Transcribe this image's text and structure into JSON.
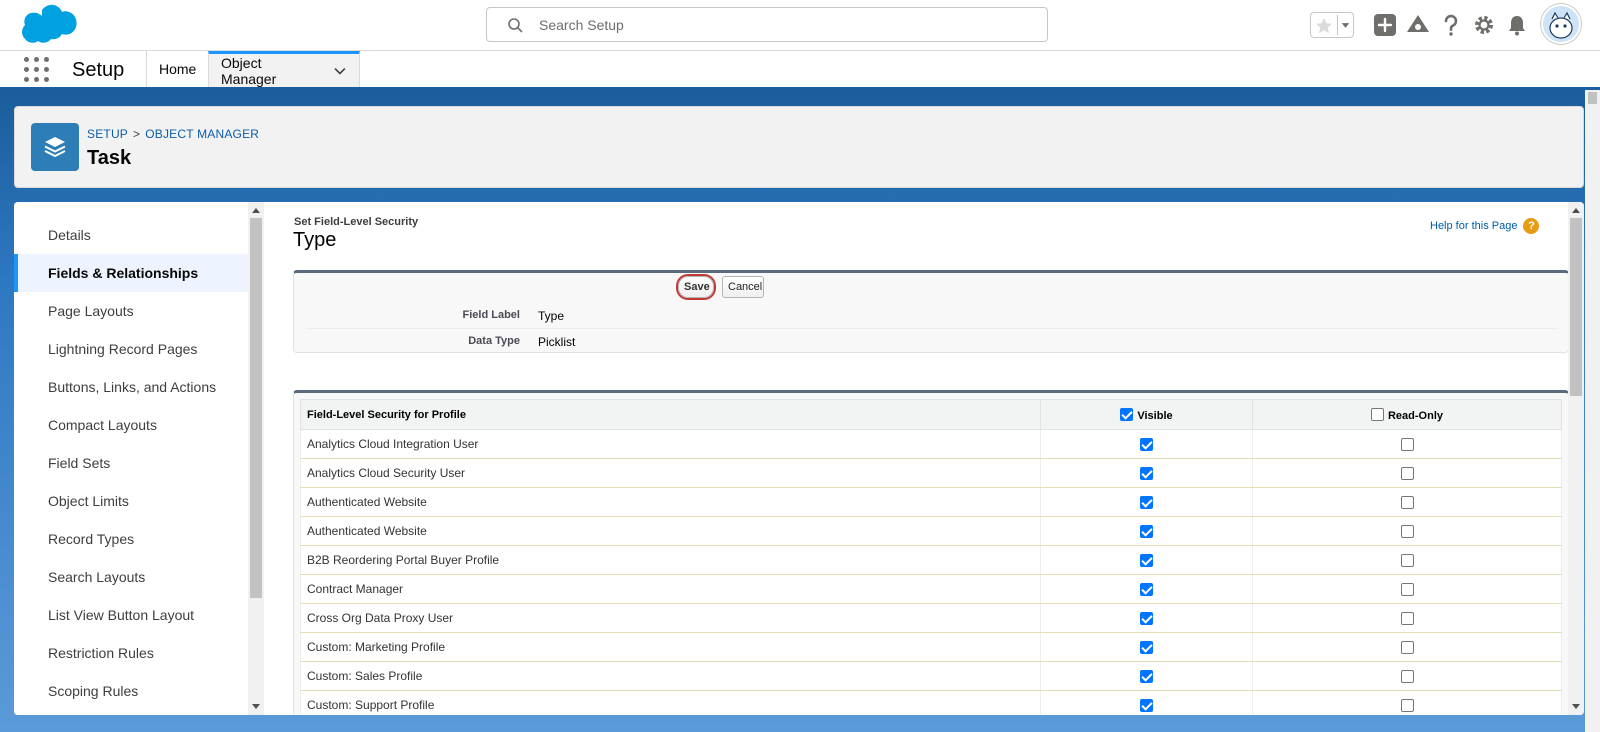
{
  "header": {
    "search_placeholder": "Search Setup",
    "icons": [
      "favorites-star-icon",
      "add-icon",
      "trailhead-icon",
      "help-icon",
      "gear-icon",
      "bell-icon",
      "avatar"
    ]
  },
  "nav": {
    "app_name": "Setup",
    "tabs": [
      {
        "label": "Home"
      },
      {
        "label": "Object Manager"
      }
    ]
  },
  "page_header": {
    "breadcrumb": [
      "SETUP",
      "OBJECT MANAGER"
    ],
    "breadcrumb_sep": ">",
    "title": "Task"
  },
  "sidebar": {
    "items": [
      {
        "label": "Details"
      },
      {
        "label": "Fields & Relationships"
      },
      {
        "label": "Page Layouts"
      },
      {
        "label": "Lightning Record Pages"
      },
      {
        "label": "Buttons, Links, and Actions"
      },
      {
        "label": "Compact Layouts"
      },
      {
        "label": "Field Sets"
      },
      {
        "label": "Object Limits"
      },
      {
        "label": "Record Types"
      },
      {
        "label": "Search Layouts"
      },
      {
        "label": "List View Button Layout"
      },
      {
        "label": "Restriction Rules"
      },
      {
        "label": "Scoping Rules"
      }
    ],
    "active_index": 1
  },
  "content": {
    "subtitle": "Set Field-Level Security",
    "title": "Type",
    "help_link": "Help for this Page",
    "help_icon_glyph": "?",
    "buttons": {
      "save": "Save",
      "cancel": "Cancel"
    },
    "details": [
      {
        "label": "Field Label",
        "value": "Type"
      },
      {
        "label": "Data Type",
        "value": "Picklist"
      }
    ],
    "table": {
      "headers": {
        "profile": "Field-Level Security for Profile",
        "visible": "Visible",
        "read_only": "Read-Only"
      },
      "header_visible_checked": true,
      "header_readonly_checked": false,
      "rows": [
        {
          "profile": "Analytics Cloud Integration User",
          "visible": true,
          "read_only": false
        },
        {
          "profile": "Analytics Cloud Security User",
          "visible": true,
          "read_only": false
        },
        {
          "profile": "Authenticated Website",
          "visible": true,
          "read_only": false
        },
        {
          "profile": "Authenticated Website",
          "visible": true,
          "read_only": false
        },
        {
          "profile": "B2B Reordering Portal Buyer Profile",
          "visible": true,
          "read_only": false
        },
        {
          "profile": "Contract Manager",
          "visible": true,
          "read_only": false
        },
        {
          "profile": "Cross Org Data Proxy User",
          "visible": true,
          "read_only": false
        },
        {
          "profile": "Custom: Marketing Profile",
          "visible": true,
          "read_only": false
        },
        {
          "profile": "Custom: Sales Profile",
          "visible": true,
          "read_only": false
        },
        {
          "profile": "Custom: Support Profile",
          "visible": true,
          "read_only": false
        }
      ]
    }
  },
  "colors": {
    "brand_blue": "#1b96ff",
    "header_blue": "#1a5d9a",
    "object_icon": "#2d7eb6",
    "link": "#0b5cab",
    "highlight_ring": "#c23934"
  }
}
